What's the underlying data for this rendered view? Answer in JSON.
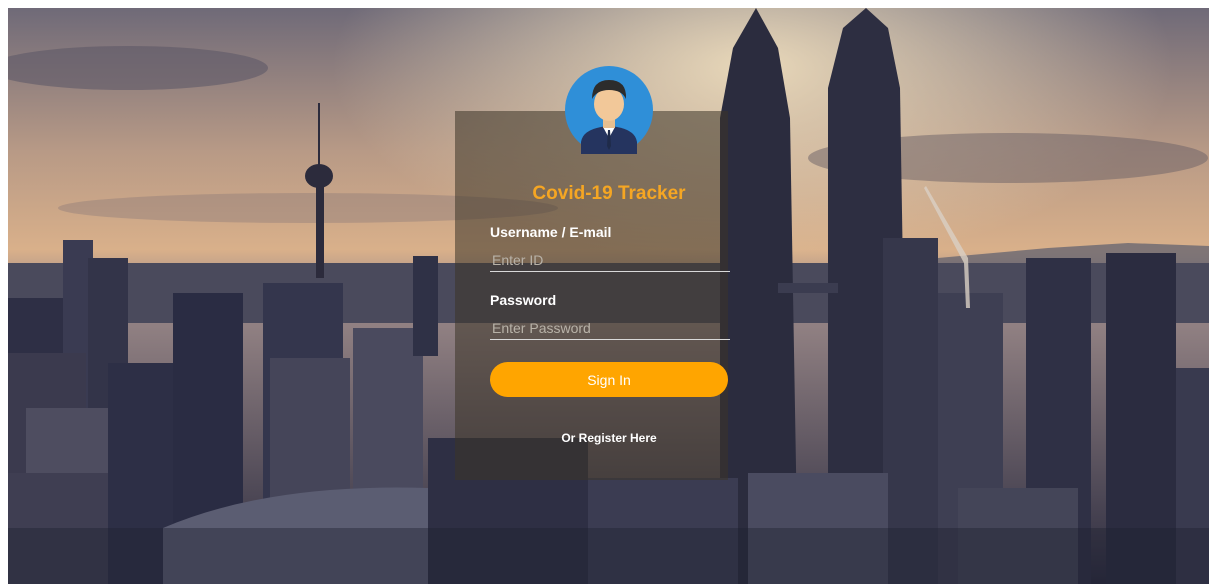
{
  "app": {
    "title": "Covid-19 Tracker",
    "avatar_icon": "user-avatar-icon"
  },
  "form": {
    "username_label": "Username / E-mail",
    "username_placeholder": "Enter ID",
    "username_value": "",
    "password_label": "Password",
    "password_placeholder": "Enter Password",
    "password_value": "",
    "signin_label": "Sign In",
    "register_link": "Or Register Here"
  },
  "colors": {
    "accent": "#ffa500",
    "title": "#f5a623",
    "panel": "rgba(60,52,40,0.55)"
  }
}
